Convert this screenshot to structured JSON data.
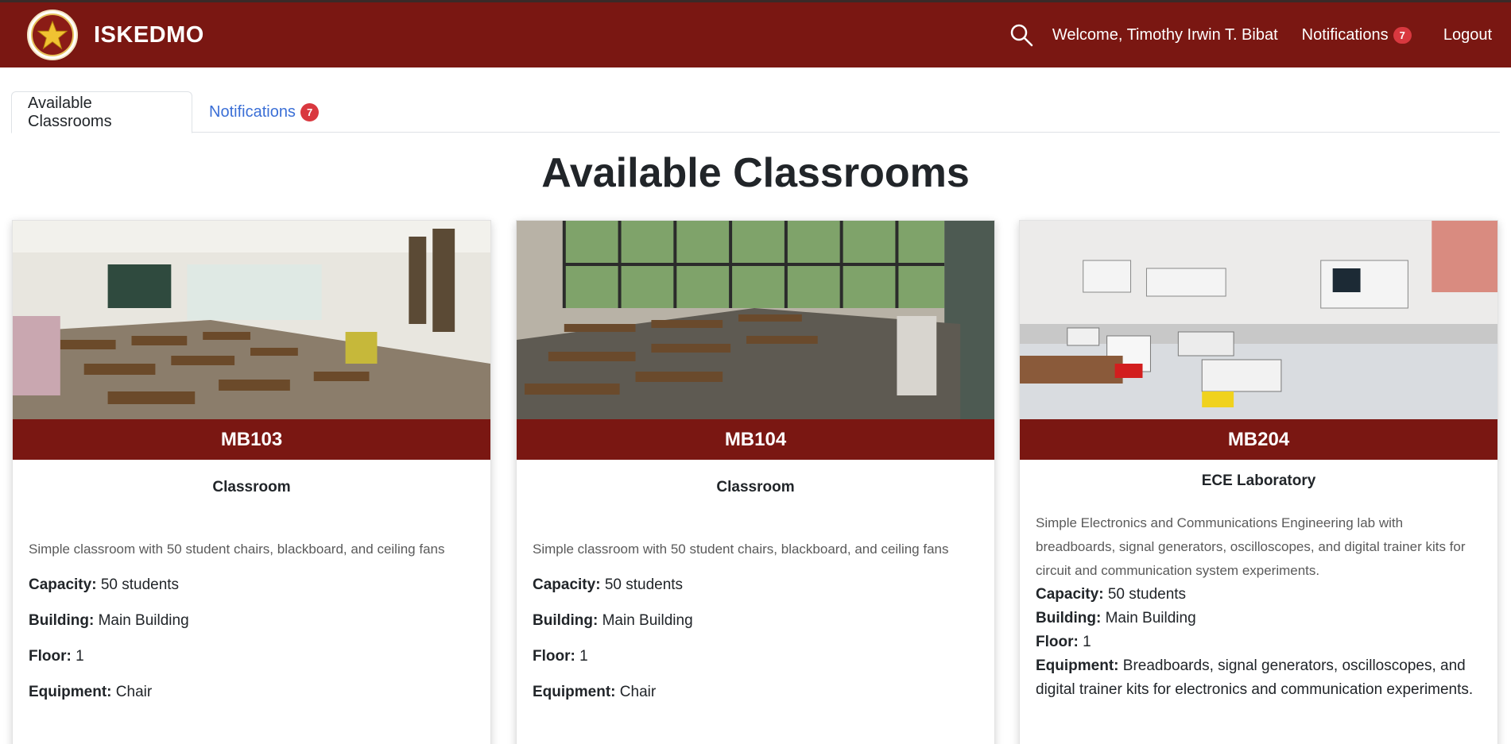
{
  "app": {
    "name": "ISKEDMO"
  },
  "nav": {
    "welcome": "Welcome, Timothy Irwin T. Bibat",
    "notifications_label": "Notifications",
    "notifications_count": "7",
    "logout": "Logout"
  },
  "tabs": [
    {
      "label": "Available Classrooms",
      "active": true
    },
    {
      "label": "Notifications",
      "count": "7"
    }
  ],
  "page_title": "Available Classrooms",
  "labels": {
    "capacity": "Capacity:",
    "building": "Building:",
    "floor": "Floor:",
    "equipment": "Equipment:"
  },
  "rooms": [
    {
      "name": "MB103",
      "type": "Classroom",
      "description": "Simple classroom with 50 student chairs, blackboard, and ceiling fans",
      "capacity": "50 students",
      "building": "Main Building",
      "floor": "1",
      "equipment": "Chair"
    },
    {
      "name": "MB104",
      "type": "Classroom",
      "description": "Simple classroom with 50 student chairs, blackboard, and ceiling fans",
      "capacity": "50 students",
      "building": "Main Building",
      "floor": "1",
      "equipment": "Chair"
    },
    {
      "name": "MB204",
      "type": "ECE Laboratory",
      "description": "Simple Electronics and Communications Engineering lab with breadboards, signal generators, oscilloscopes, and digital trainer kits for circuit and communication system experiments.",
      "capacity": "50 students",
      "building": "Main Building",
      "floor": "1",
      "equipment": "Breadboards, signal generators, oscilloscopes, and digital trainer kits for electronics and communication experiments."
    }
  ],
  "colors": {
    "brand": "#7a1712",
    "badge": "#d9383f",
    "link": "#3b6fd6"
  }
}
